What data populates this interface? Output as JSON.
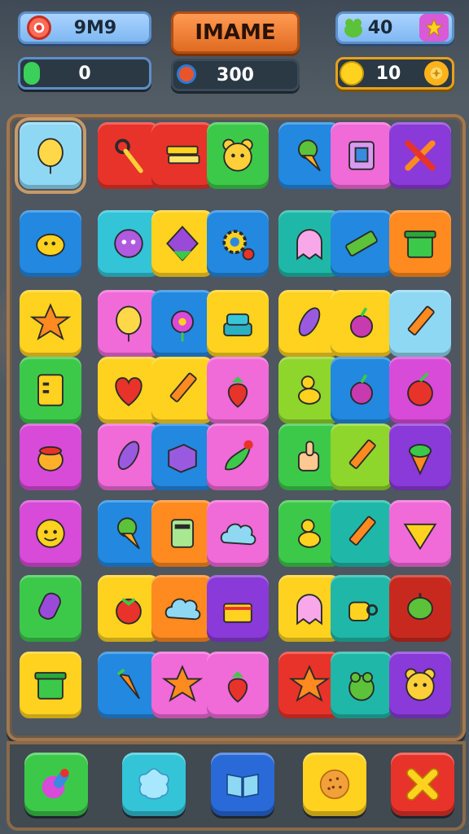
{
  "hud": {
    "player_name": "9M9",
    "title": "IMAME",
    "lives_count": "40",
    "gems_count": "0",
    "score": "300",
    "coins_count": "10"
  },
  "colors": {
    "red": "#e8332a",
    "yellow": "#ffd21f",
    "green": "#3cc94a",
    "lime": "#8ed52c",
    "blue": "#2288e0",
    "cyan": "#33c4d8",
    "pink": "#f06ad8",
    "purple": "#8a3ad8",
    "orange": "#ff8a1f",
    "teal": "#1fb8a8",
    "lightblue": "#8fd8f4",
    "darkred": "#c8291e",
    "magenta": "#d84ad8"
  },
  "board": {
    "rows": [
      [
        "lightblue:balloon-icon",
        "red:pin-icon",
        "red:stack-icon",
        "green:bear-icon",
        "blue:ice-cream-icon",
        "pink:box-icon",
        "purple:tools-icon"
      ],
      [
        "blue:lemon-icon",
        "cyan:monster-icon",
        "yellow:diamond-icon",
        "blue:gear-icon",
        "teal:ghost-icon",
        "blue:eraser-icon",
        "orange:bin-icon"
      ],
      [
        "yellow:star-icon",
        "pink:balloon-icon",
        "blue:flower-icon",
        "yellow:cake-icon",
        "yellow:feather-icon",
        "yellow:berry-icon",
        "lightblue:pencil-icon"
      ],
      [
        "green:notebook-icon",
        "yellow:heart-icon",
        "yellow:pencil-icon",
        "pink:strawberry-icon",
        "lime:duck-icon",
        "blue:berry-icon",
        "magenta:apple-icon"
      ],
      [
        "magenta:pot-icon",
        "pink:feather-icon",
        "blue:cube-icon",
        "pink:chili-icon",
        "green:thumb-icon",
        "lime:pencil-icon",
        "purple:acorn-icon"
      ],
      [
        "magenta:smiley-icon",
        "blue:ice-cream-icon",
        "orange:calculator-icon",
        "pink:cloud-icon",
        "green:duck-icon",
        "teal:pencil-icon",
        "pink:chip-icon"
      ],
      [
        "green:popsicle-icon",
        "yellow:tomato-icon",
        "orange:cloud-icon",
        "purple:gift-icon",
        "yellow:ghost-icon",
        "teal:cup-icon",
        "darkred:leaf-icon"
      ],
      [
        "yellow:bin-icon",
        "blue:carrot-icon",
        "pink:star-icon",
        "pink:strawberry-icon",
        "red:star-icon",
        "teal:frog-icon",
        "purple:bear-icon"
      ]
    ]
  },
  "bottom": {
    "buttons": [
      "paint-brush-icon",
      "star-burst-icon",
      "book-icon",
      "cookie-icon",
      "close-icon"
    ]
  }
}
